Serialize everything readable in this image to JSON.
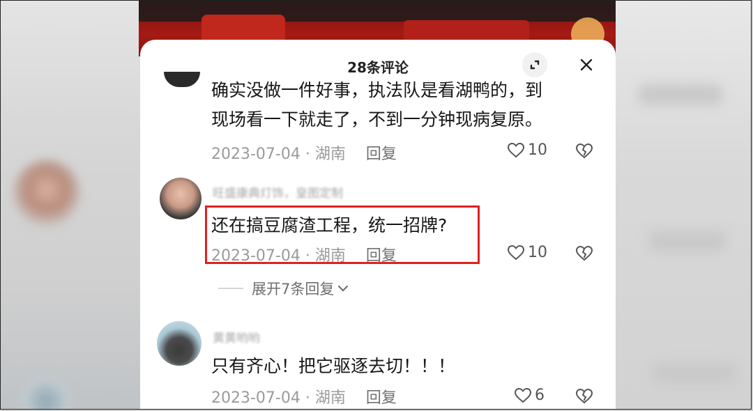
{
  "panel": {
    "title": "28条评论",
    "expand_icon": "expand-icon",
    "close_icon": "close-icon"
  },
  "comments": [
    {
      "text_line1": "确实没做一件好事，执法队是看湖鸭的，到",
      "text_line2": "现场看一下就走了，不到一分钟现病复原。",
      "date": "2023-07-04",
      "location": "湖南",
      "reply": "回复",
      "likes": "10"
    },
    {
      "username": "旺盛康典灯饰，皇图定制",
      "text": "还在搞豆腐渣工程，统一招牌?",
      "date": "2023-07-04",
      "location": "湖南",
      "reply": "回复",
      "likes": "10",
      "expand_replies": "展开7条回复"
    },
    {
      "username": "黄黄哟哟",
      "text": "只有齐心！把它驱逐去切！！！",
      "date": "2023-07-04",
      "location": "湖南",
      "reply": "回复",
      "likes": "6"
    }
  ],
  "separator": "·",
  "colors": {
    "highlight_border": "#e02020",
    "panel_bg": "#ffffff"
  }
}
